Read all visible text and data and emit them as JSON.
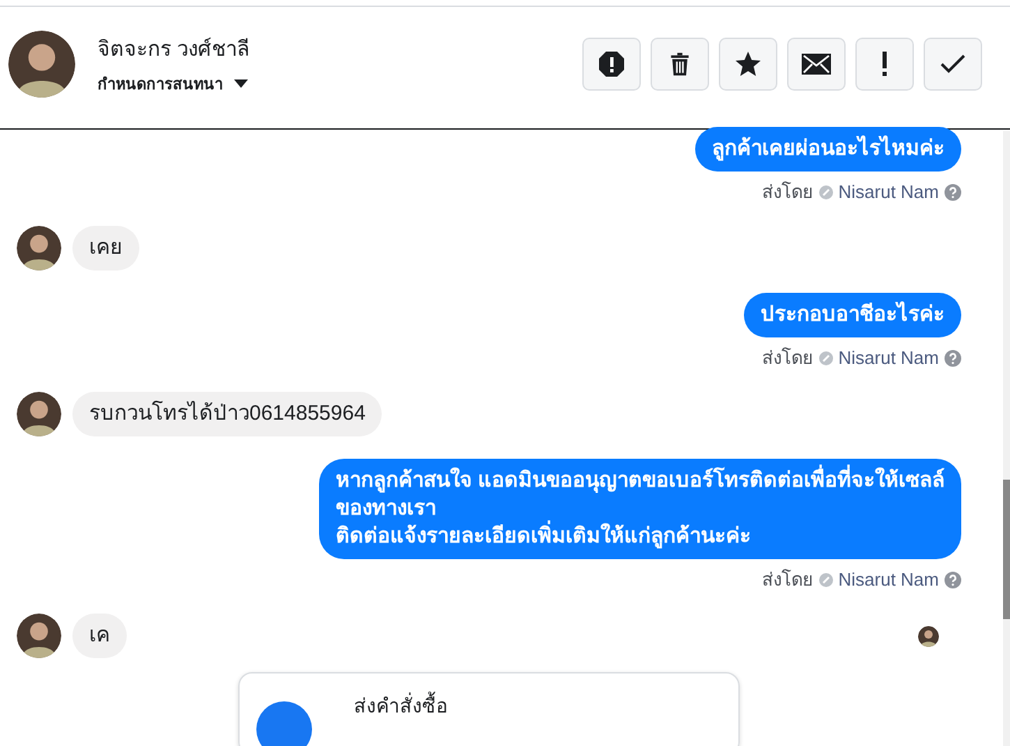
{
  "header": {
    "contact_name": "จิตจะกร วงศ์ชาลี",
    "subtitle": "กำหนดการสนทนา",
    "actions": [
      {
        "kind": "alert"
      },
      {
        "kind": "trash"
      },
      {
        "kind": "star"
      },
      {
        "kind": "mail"
      },
      {
        "kind": "exclamation"
      },
      {
        "kind": "check"
      }
    ]
  },
  "messages": [
    {
      "kind": "outgoing",
      "lines": [
        "ลูกค้าเคยผ่อนอะไรไหมค่ะ"
      ],
      "sent_by_label": "ส่งโดย",
      "sender": "Nisarut Nam"
    },
    {
      "kind": "incoming",
      "lines": [
        "เคย"
      ]
    },
    {
      "kind": "outgoing",
      "lines": [
        "ประกอบอาชีอะไรค่ะ"
      ],
      "sent_by_label": "ส่งโดย",
      "sender": "Nisarut Nam"
    },
    {
      "kind": "incoming",
      "lines": [
        "รบกวนโทรได้ป่าว0614855964"
      ]
    },
    {
      "kind": "outgoing",
      "lines": [
        "หากลูกค้าสนใจ แอดมินขออนุญาตขอเบอร์โทรติดต่อเพื่อที่จะให้เซลล์",
        "ของทางเรา",
        "ติดต่อแจ้งรายละเอียดเพิ่มเติมให้แก่ลูกค้านะค่ะ"
      ],
      "sent_by_label": "ส่งโดย",
      "sender": "Nisarut Nam"
    },
    {
      "kind": "incoming",
      "lines": [
        "เค"
      ],
      "seen": true
    },
    {
      "kind": "order_card",
      "title": "ส่งคำสั่งซื้อ"
    }
  ]
}
